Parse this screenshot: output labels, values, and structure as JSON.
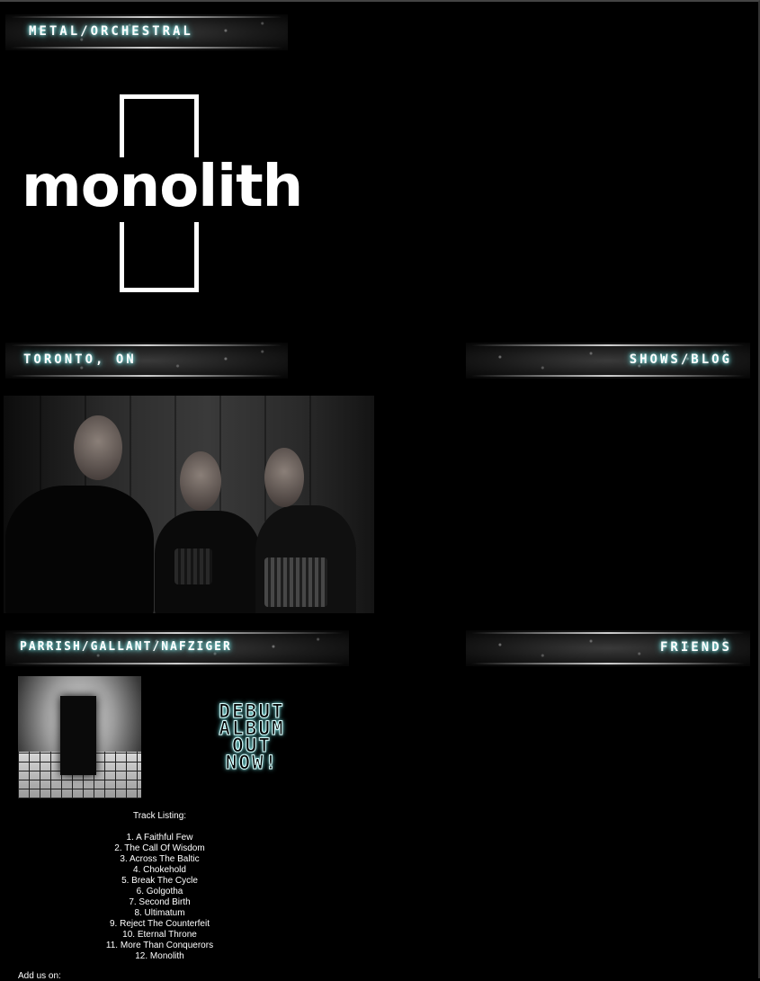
{
  "banners": {
    "genre": "METAL/ORCHESTRAL",
    "location": "TORONTO, ON",
    "shows": "SHOWS/BLOG",
    "members": "PARRISH/GALLANT/NAFZIGER",
    "friends": "FRIENDS"
  },
  "logo": {
    "text": "monolith"
  },
  "promo": {
    "line1": "DEBUT",
    "line2": "ALBUM",
    "line3": "OUT",
    "line4": "NOW!"
  },
  "tracklist": {
    "heading": "Track Listing:",
    "tracks": [
      "1. A Faithful Few",
      "2. The Call Of Wisdom",
      "3. Across The Baltic",
      "4. Chokehold",
      "5. Break The Cycle",
      "6. Golgotha",
      "7. Second Birth",
      "8. Ultimatum",
      "9. Reject The Counterfeit",
      "10. Eternal Throne",
      "11. More Than Conquerors",
      "12. Monolith"
    ]
  },
  "footer": {
    "add_us": "Add us on:"
  },
  "colors": {
    "background": "#000000",
    "glow": "#9ffff5",
    "text": "#ffffff"
  }
}
